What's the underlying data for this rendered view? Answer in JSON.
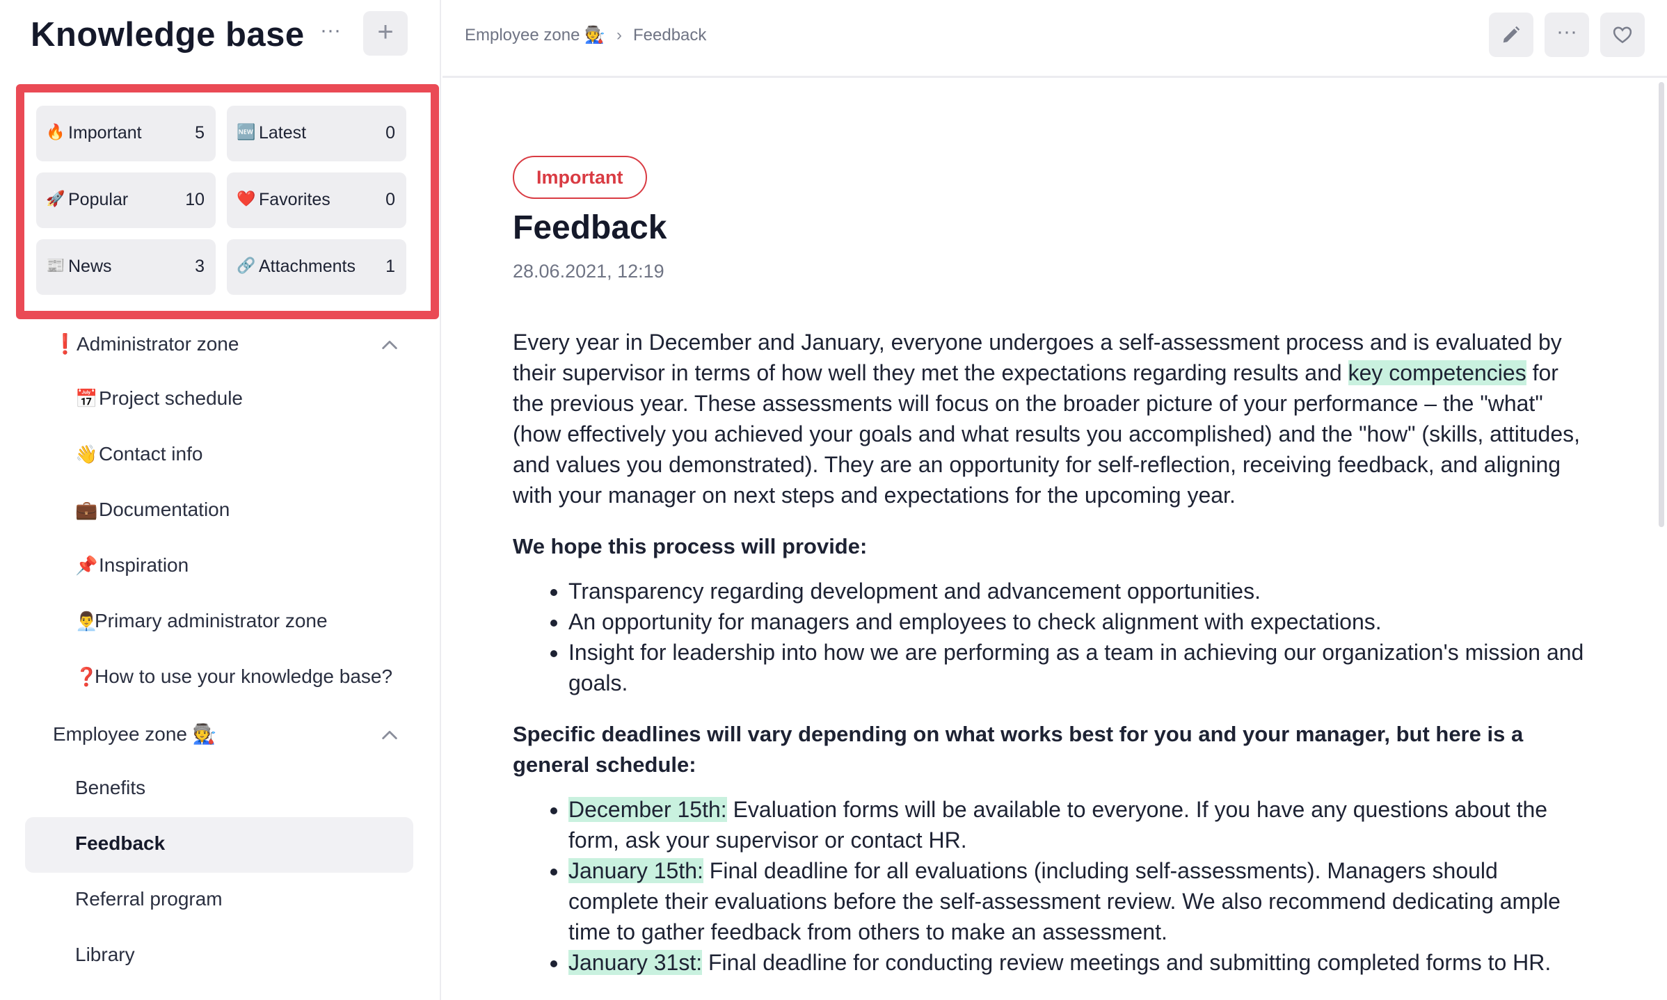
{
  "sidebar": {
    "title": "Knowledge base",
    "more_label": "···",
    "add_label": "+",
    "quick_links": [
      {
        "icon": "🔥",
        "icon_name": "fire-icon",
        "label": "Important",
        "count": "5"
      },
      {
        "icon": "🆕",
        "icon_name": "new-icon",
        "label": "Latest",
        "count": "0"
      },
      {
        "icon": "🚀",
        "icon_name": "rocket-icon",
        "label": "Popular",
        "count": "10"
      },
      {
        "icon": "❤️",
        "icon_name": "heart-icon",
        "label": "Favorites",
        "count": "0"
      },
      {
        "icon": "📰",
        "icon_name": "newspaper-icon",
        "label": "News",
        "count": "3"
      },
      {
        "icon": "🔗",
        "icon_name": "link-icon",
        "label": "Attachments",
        "count": "1"
      }
    ],
    "admin_zone": {
      "icon": "❗",
      "label": "Administrator zone",
      "items": [
        {
          "icon": "📅",
          "label": "Project schedule"
        },
        {
          "icon": "👋",
          "label": "Contact info"
        },
        {
          "icon": "💼",
          "label": "Documentation"
        },
        {
          "icon": "📌",
          "label": "Inspiration"
        },
        {
          "icon": "👨‍💼",
          "label": "Primary administrator zone"
        },
        {
          "icon": "❓",
          "label": "How to use your knowledge base?"
        }
      ]
    },
    "employee_zone": {
      "label": "Employee zone 🧑‍🏭",
      "items": [
        {
          "label": "Benefits"
        },
        {
          "label": "Feedback"
        },
        {
          "label": "Referral program"
        },
        {
          "label": "Library"
        }
      ]
    }
  },
  "topbar": {
    "breadcrumb": [
      "Employee zone 🧑‍🏭",
      "Feedback"
    ],
    "separator": "›",
    "more_label": "···"
  },
  "article": {
    "badge": "Important",
    "title": "Feedback",
    "date": "28.06.2021, 12:19",
    "intro_before": "Every year in December and January, everyone undergoes a self-assessment process and is evaluated by their supervisor in terms of how well they met the expectations regarding results and ",
    "intro_highlight": "key competencies",
    "intro_after": " for the previous year. These assessments will focus on the broader picture of your performance – the \"what\" (how effectively you achieved your goals and what results you accomplished) and the \"how\" (skills, attitudes, and values you demonstrated). They are an opportunity for self-reflection, receiving feedback, and aligning with your manager on next steps and expectations for the upcoming year.",
    "heading1": "We hope this process will provide:",
    "list1": [
      "Transparency regarding development and advancement opportunities.",
      "An opportunity for managers and employees to check alignment with expectations.",
      "Insight for leadership into how we are performing as a team in achieving our organization's mission and goals."
    ],
    "heading2": "Specific deadlines will vary depending on what works best for you and your manager, but here is a general schedule:",
    "schedule": [
      {
        "date": "December 15th:",
        "text": " Evaluation forms will be available to everyone. If you have any questions about the form, ask your supervisor or contact HR."
      },
      {
        "date": "January 15th:",
        "text": " Final deadline for all evaluations (including self-assessments). Managers should complete their evaluations before the self-assessment review. We also recommend dedicating ample time to gather feedback from others to make an assessment."
      },
      {
        "date": "January 31st:",
        "text": " Final deadline for conducting review meetings and submitting completed forms to HR."
      }
    ]
  }
}
